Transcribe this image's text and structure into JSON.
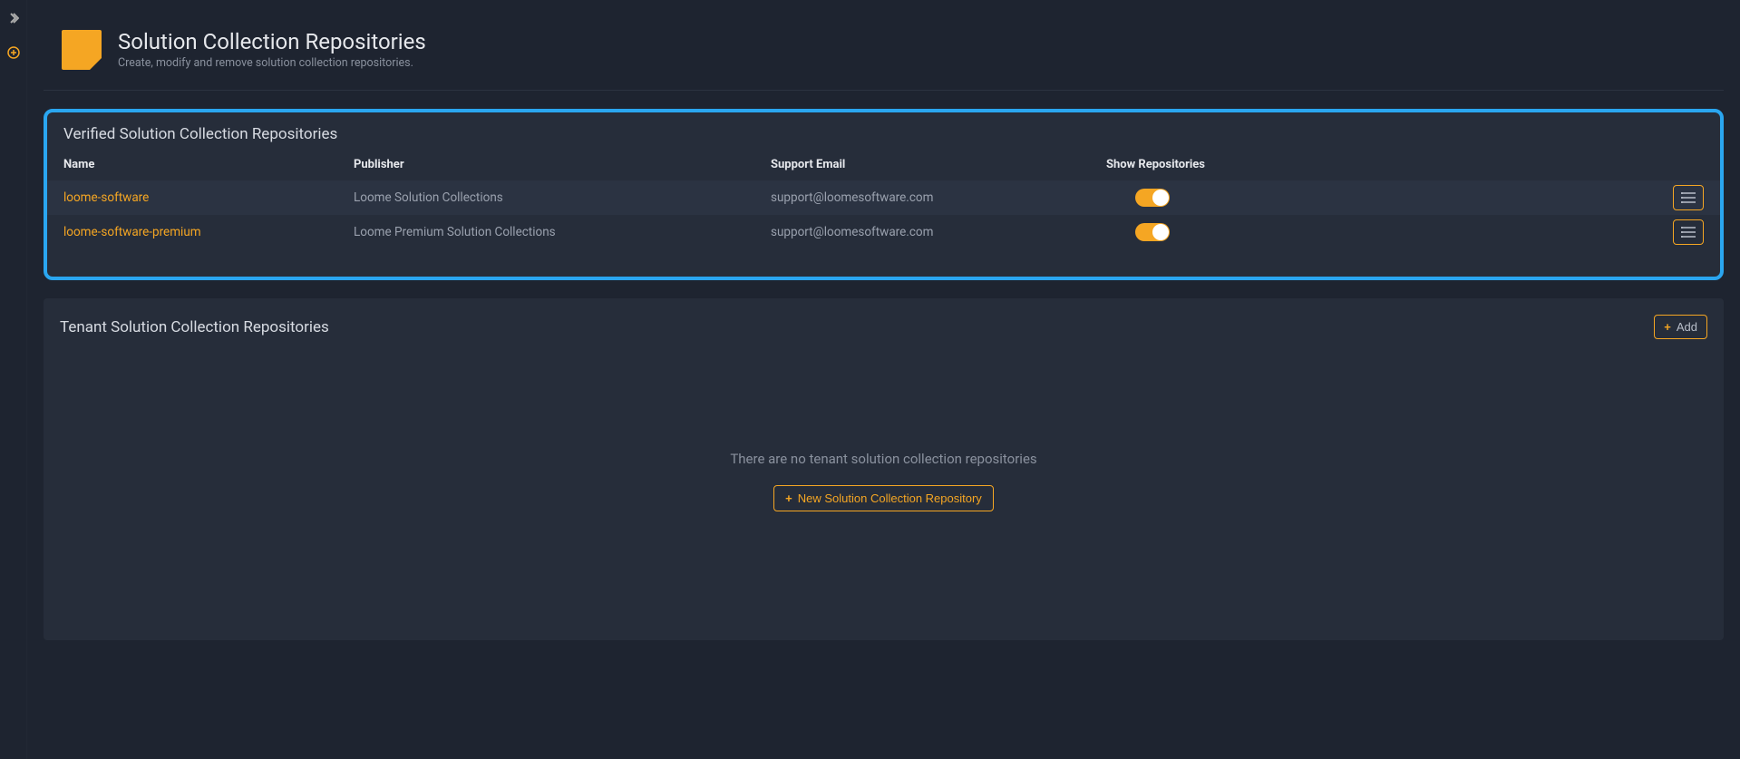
{
  "header": {
    "title": "Solution Collection Repositories",
    "subtitle": "Create, modify and remove solution collection repositories."
  },
  "verified": {
    "title": "Verified Solution Collection Repositories",
    "columns": {
      "name": "Name",
      "publisher": "Publisher",
      "email": "Support Email",
      "show": "Show Repositories"
    },
    "rows": [
      {
        "name": "loome-software",
        "publisher": "Loome Solution Collections",
        "email": "support@loomesoftware.com"
      },
      {
        "name": "loome-software-premium",
        "publisher": "Loome Premium Solution Collections",
        "email": "support@loomesoftware.com"
      }
    ]
  },
  "tenant": {
    "title": "Tenant Solution Collection Repositories",
    "add_label": "Add",
    "empty_message": "There are no tenant solution collection repositories",
    "new_button": "New Solution Collection Repository"
  }
}
